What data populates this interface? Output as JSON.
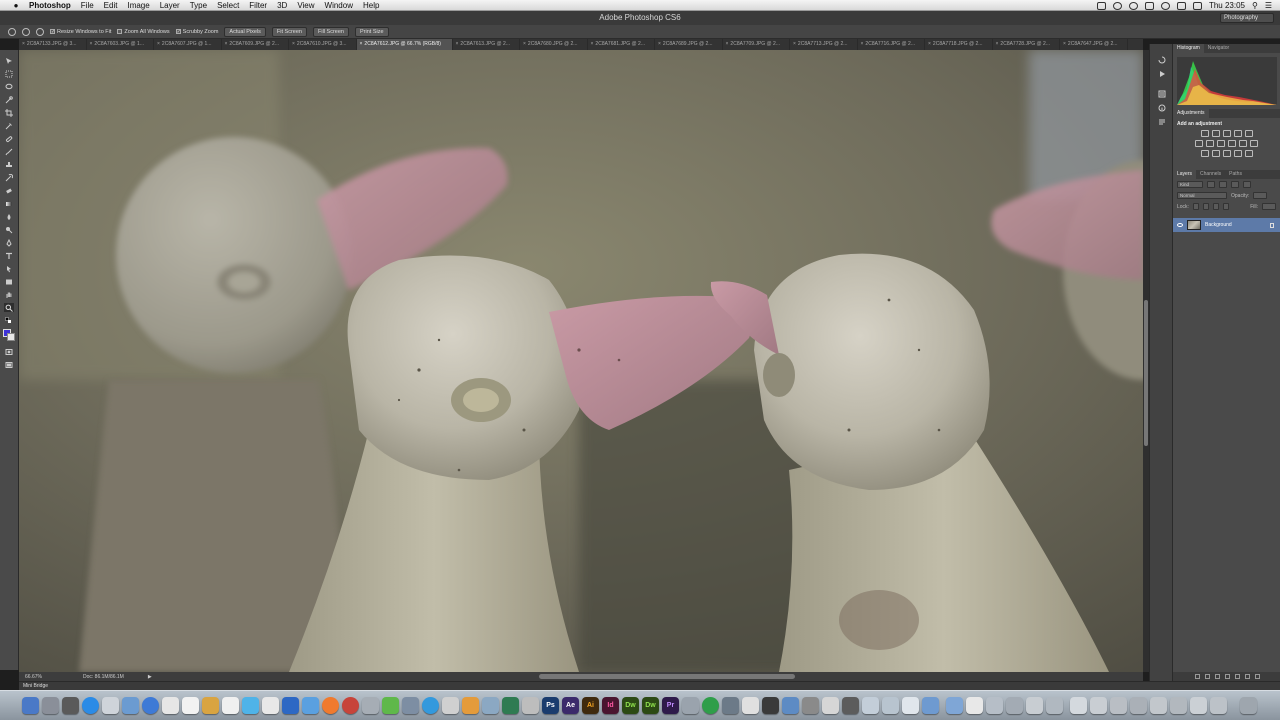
{
  "menubar": {
    "app_name": "Photoshop",
    "items": [
      "File",
      "Edit",
      "Image",
      "Layer",
      "Type",
      "Select",
      "Filter",
      "3D",
      "View",
      "Window",
      "Help"
    ],
    "clock": "Thu 23:05"
  },
  "window": {
    "title": "Adobe Photoshop CS6",
    "workspace": "Photography"
  },
  "options": {
    "resize_windows": "Resize Windows to Fit",
    "zoom_all": "Zoom All Windows",
    "scrubby_zoom": "Scrubby Zoom",
    "actual_pixels": "Actual Pixels",
    "fit_screen": "Fit Screen",
    "fill_screen": "Fill Screen",
    "print_size": "Print Size"
  },
  "tabs": [
    "2C8A7133.JPG @ 3...",
    "2C8A7603.JPG @ 1...",
    "2C8A7607.JPG @ 1...",
    "2C8A7609.JPG @ 2...",
    "2C8A7610.JPG @ 3...",
    "2C8A7612.JPG @ 66.7% (RGB/8)",
    "2C8A7613.JPG @ 2...",
    "2C8A7680.JPG @ 2...",
    "2C8A7681.JPG @ 2...",
    "2C8A7689.JPG @ 2...",
    "2C8A7709.JPG @ 2...",
    "2C8A7713.JPG @ 2...",
    "2C8A7716.JPG @ 2...",
    "2C8A7718.JPG @ 2...",
    "2C8A7728.JPG @ 2...",
    "2C8A7647.JPG @ 2..."
  ],
  "status": {
    "zoom": "66.67%",
    "doc": "Doc: 86.1M/86.1M"
  },
  "panels": {
    "histogram_tab": "Histogram",
    "navigator_tab": "Navigator",
    "adjustments_tab": "Adjustments",
    "add_adjustment": "Add an adjustment",
    "layers_tab": "Layers",
    "channels_tab": "Channels",
    "paths_tab": "Paths",
    "kind": "Kind",
    "blend_mode": "Normal",
    "opacity_label": "Opacity:",
    "lock_label": "Lock:",
    "fill_label": "Fill:",
    "layer_name": "Background"
  },
  "mini_bridge": "Mini Bridge",
  "dock_badges": {
    "ps": "Ps",
    "ae": "Ae",
    "ai": "Ai",
    "id": "Id",
    "dw": "Dw",
    "dw2": "Dw",
    "pr": "Pr"
  },
  "colors": {
    "foreground": "#3c31d8",
    "background": "#e7e7e7",
    "layer_highlight": "#5d7aa8"
  }
}
